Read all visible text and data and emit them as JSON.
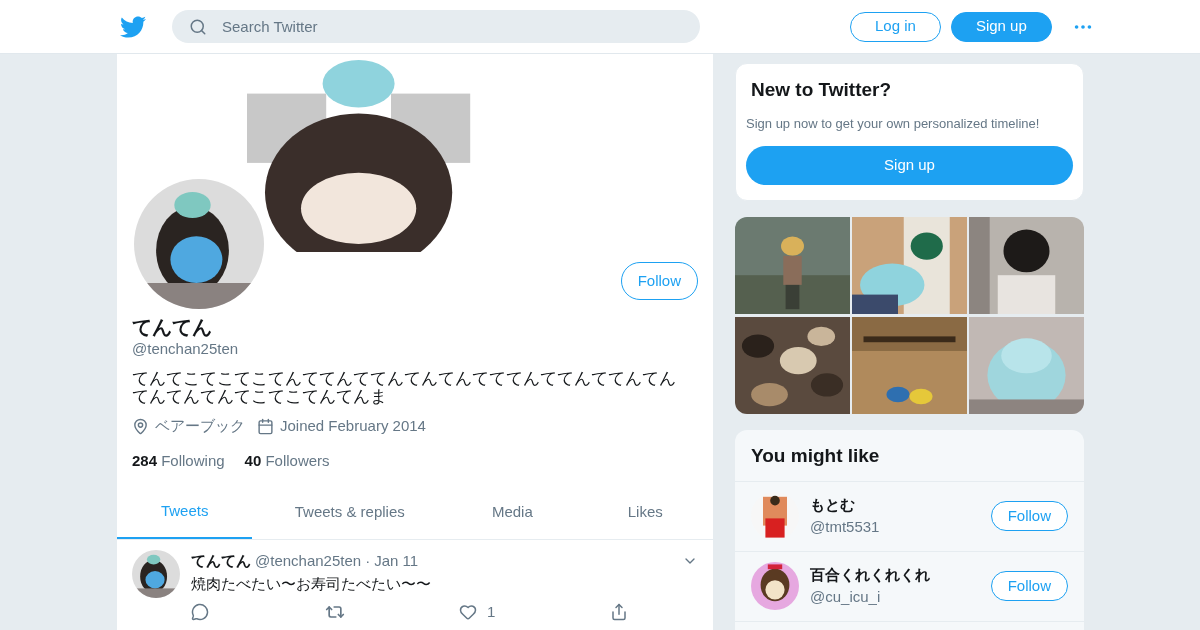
{
  "header": {
    "search": {
      "placeholder": "Search Twitter"
    },
    "buttons": [
      {
        "label": "Log in",
        "kind": "outline"
      },
      {
        "label": "Sign up",
        "kind": "filled"
      }
    ]
  },
  "profile": {
    "name": "てんてん",
    "handle": "@tenchan25ten",
    "bio": "てんてこてこてこてんててんててんてんてんてててんててんててんてんてんてんてんてこてこてんてんま",
    "location": "ベアーブック",
    "joined": "Joined February 2014",
    "follow_button": "Follow",
    "stats": [
      {
        "count": "284",
        "label": "Following"
      },
      {
        "count": "40",
        "label": "Followers"
      }
    ]
  },
  "tabs": [
    {
      "label": "Tweets",
      "selected": true
    },
    {
      "label": "Tweets & replies",
      "selected": false
    },
    {
      "label": "Media",
      "selected": false
    },
    {
      "label": "Likes",
      "selected": false
    }
  ],
  "tweets": [
    {
      "name": "てんてん",
      "handle": "@tenchan25ten",
      "separator": "·",
      "date": "Jan 11",
      "text": "焼肉たべたい〜お寿司たべたい〜〜",
      "likes": "1"
    }
  ],
  "signup_card": {
    "title": "New to Twitter?",
    "text": "Sign up now to get your own personalized timeline!",
    "button": "Sign up"
  },
  "suggestions": {
    "title": "You might like",
    "items": [
      {
        "name": "もとむ",
        "handle": "@tmt5531",
        "button": "Follow"
      },
      {
        "name": "百合くれくれくれ",
        "handle": "@cu_icu_i",
        "button": "Follow"
      }
    ]
  }
}
